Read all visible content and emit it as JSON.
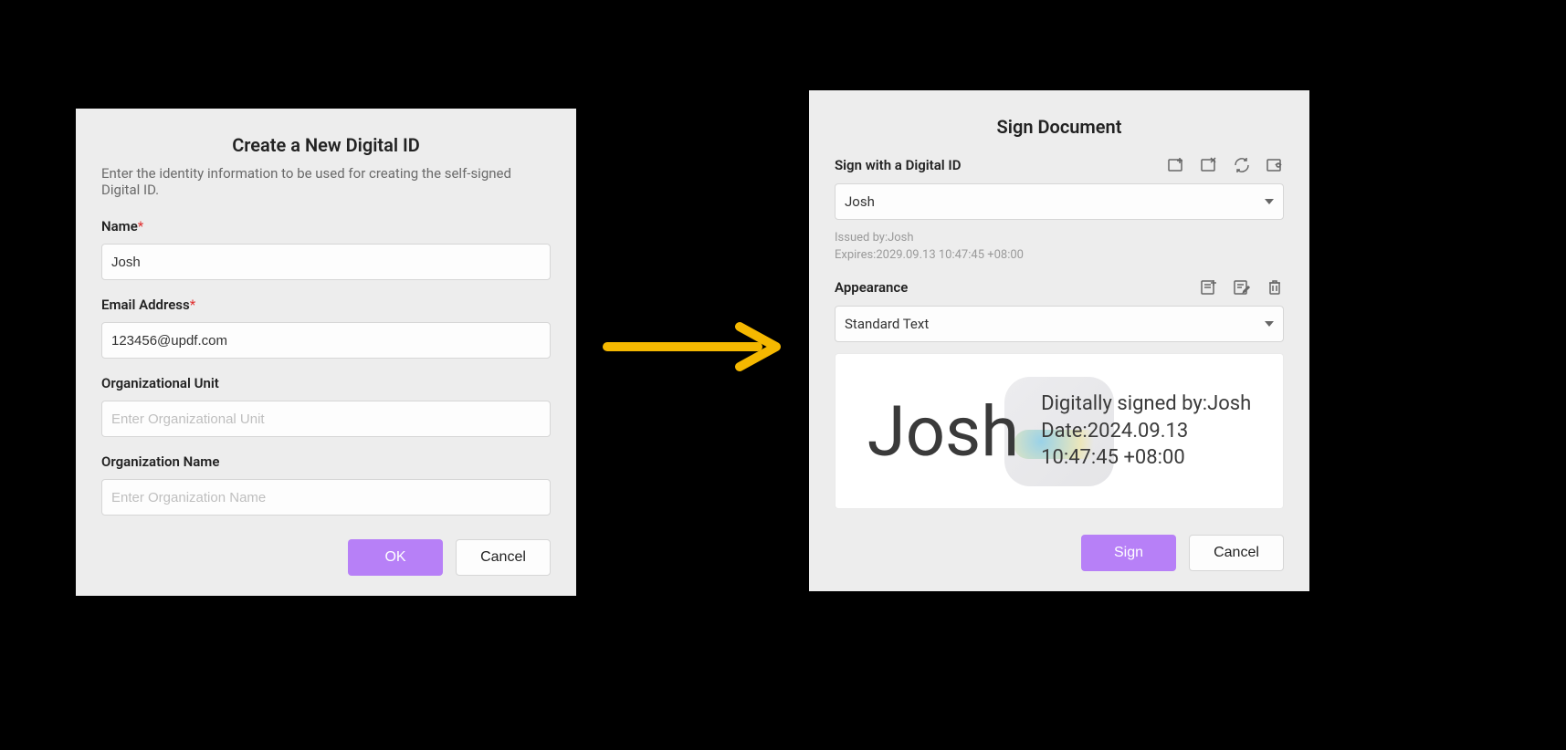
{
  "left_dialog": {
    "title": "Create a New Digital ID",
    "subtitle": "Enter the identity information to be used for creating the self-signed Digital ID.",
    "fields": {
      "name": {
        "label": "Name",
        "value": "Josh",
        "required": "*"
      },
      "email": {
        "label": "Email Address",
        "value": "123456@updf.com",
        "required": "*"
      },
      "org_unit": {
        "label": "Organizational Unit",
        "placeholder": "Enter Organizational Unit"
      },
      "org_name": {
        "label": "Organization Name",
        "placeholder": "Enter Organization Name"
      }
    },
    "buttons": {
      "ok": "OK",
      "cancel": "Cancel"
    }
  },
  "right_dialog": {
    "title": "Sign Document",
    "sections": {
      "sign_with": "Sign with a Digital ID",
      "appearance": "Appearance"
    },
    "id_select": "Josh",
    "issued_by": "Issued by:Josh",
    "expires": "Expires:2029.09.13 10:47:45 +08:00",
    "appearance_select": "Standard Text",
    "preview": {
      "name": "Josh",
      "line1": "Digitally signed by:Josh",
      "line2": "Date:2024.09.13",
      "line3": "10:47:45 +08:00"
    },
    "buttons": {
      "sign": "Sign",
      "cancel": "Cancel"
    }
  }
}
